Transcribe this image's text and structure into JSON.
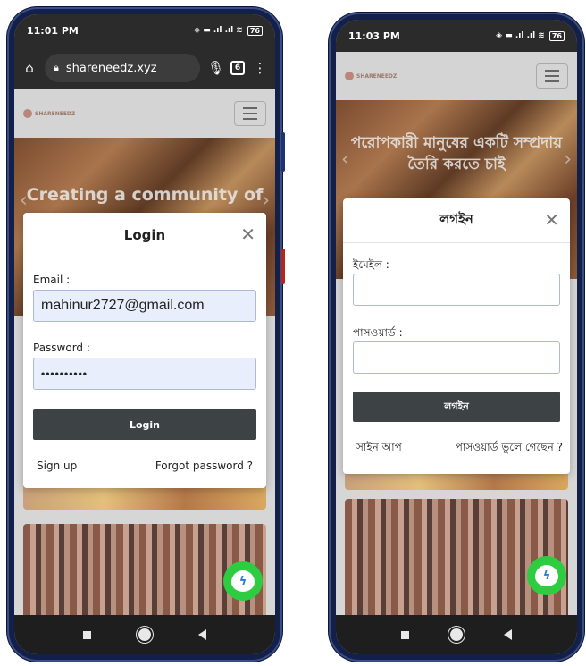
{
  "left": {
    "status": {
      "time": "11:01 PM",
      "signal": "◈ ▬ .ıl .ıl ≋",
      "battery": "76"
    },
    "browser": {
      "url": "shareneedz.xyz",
      "tab_count": "6",
      "home_icon": "home-icon",
      "lock_icon": "lock-icon",
      "mic_icon": "mic-icon",
      "menu_icon": "more-vert-icon"
    },
    "site": {
      "logo": "SHARENEEDZ",
      "hero_text": "Creating a community of"
    },
    "modal": {
      "title": "Login",
      "email_label": "Email :",
      "email_value": "mahinur2727@gmail.com",
      "password_label": "Password :",
      "password_value": "••••••••••",
      "login_button": "Login",
      "signup_link": "Sign up",
      "forgot_link": "Forgot password ?"
    }
  },
  "right": {
    "status": {
      "time": "11:03 PM",
      "signal": "◈ ▬ .ıl .ıl ≋",
      "battery": "76"
    },
    "site": {
      "logo": "SHARENEEDZ",
      "hero_text": "পরোপকারী মানুষের একটি সম্প্রদায় তৈরি করতে চাই"
    },
    "modal": {
      "title": "লগইন",
      "email_label": "ইমেইল :",
      "email_value": "",
      "password_label": "পাসওয়ার্ড :",
      "password_value": "",
      "login_button": "লগইন",
      "signup_link": "সাইন আপ",
      "forgot_link": "পাসওয়ার্ড ভুলে গেছেন ?"
    }
  },
  "colors": {
    "messenger": "#2ecc40",
    "button": "#3d4345",
    "filled_input": "#e8eefb",
    "phone_frame": "#13204a"
  }
}
